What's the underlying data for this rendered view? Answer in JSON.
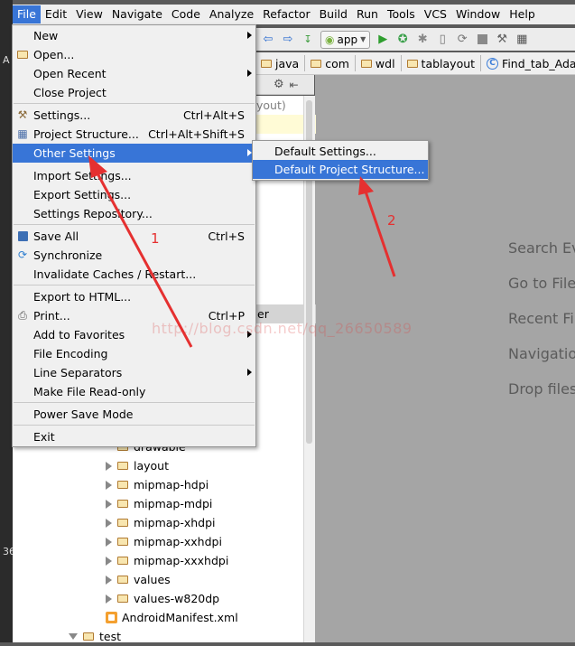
{
  "menubar": {
    "items": [
      {
        "label": "File",
        "active": true
      },
      {
        "label": "Edit"
      },
      {
        "label": "View"
      },
      {
        "label": "Navigate"
      },
      {
        "label": "Code"
      },
      {
        "label": "Analyze"
      },
      {
        "label": "Refactor"
      },
      {
        "label": "Build"
      },
      {
        "label": "Run"
      },
      {
        "label": "Tools"
      },
      {
        "label": "VCS"
      },
      {
        "label": "Window"
      },
      {
        "label": "Help"
      }
    ]
  },
  "toolbar": {
    "run_config": "app"
  },
  "breadcrumb": {
    "items": [
      "java",
      "com",
      "wdl",
      "tablayout",
      "Find_tab_Adapte"
    ]
  },
  "file_menu": {
    "items": [
      {
        "label": "New",
        "submenu": true
      },
      {
        "label": "Open..."
      },
      {
        "label": "Open Recent",
        "submenu": true
      },
      {
        "label": "Close Project"
      },
      {
        "label": "Settings...",
        "shortcut": "Ctrl+Alt+S"
      },
      {
        "label": "Project Structure...",
        "shortcut": "Ctrl+Alt+Shift+S"
      },
      {
        "label": "Other Settings",
        "submenu": true,
        "highlighted": true
      },
      {
        "label": "Import Settings..."
      },
      {
        "label": "Export Settings..."
      },
      {
        "label": "Settings Repository..."
      },
      {
        "label": "Save All",
        "shortcut": "Ctrl+S"
      },
      {
        "label": "Synchronize"
      },
      {
        "label": "Invalidate Caches / Restart..."
      },
      {
        "label": "Export to HTML..."
      },
      {
        "label": "Print...",
        "shortcut": "Ctrl+P"
      },
      {
        "label": "Add to Favorites",
        "submenu": true
      },
      {
        "label": "File Encoding"
      },
      {
        "label": "Line Separators",
        "submenu": true
      },
      {
        "label": "Make File Read-only"
      },
      {
        "label": "Power Save Mode"
      },
      {
        "label": "Exit"
      }
    ]
  },
  "other_settings_submenu": {
    "items": [
      {
        "label": "Default Settings..."
      },
      {
        "label": "Default Project Structure...",
        "highlighted": true
      }
    ]
  },
  "project_tree": {
    "partial_labels": [
      "yout)",
      "er"
    ],
    "items": [
      {
        "label": "drawable",
        "expandable": false
      },
      {
        "label": "layout",
        "expandable": true
      },
      {
        "label": "mipmap-hdpi",
        "expandable": true
      },
      {
        "label": "mipmap-mdpi",
        "expandable": true
      },
      {
        "label": "mipmap-xhdpi",
        "expandable": true
      },
      {
        "label": "mipmap-xxhdpi",
        "expandable": true
      },
      {
        "label": "mipmap-xxxhdpi",
        "expandable": true
      },
      {
        "label": "values",
        "expandable": true
      },
      {
        "label": "values-w820dp",
        "expandable": true
      },
      {
        "label": "AndroidManifest.xml",
        "expandable": false
      },
      {
        "label": "test",
        "expanded": true
      }
    ]
  },
  "editor_hints": [
    "Search Ev",
    "Go to File",
    "Recent Fil",
    "Navigatio",
    "Drop files"
  ],
  "annotations": {
    "arrow1_label": "1",
    "arrow2_label": "2"
  },
  "watermark": "http://blog.csdn.net/qq_26650589",
  "desktop_labels": [
    "A",
    "36"
  ]
}
